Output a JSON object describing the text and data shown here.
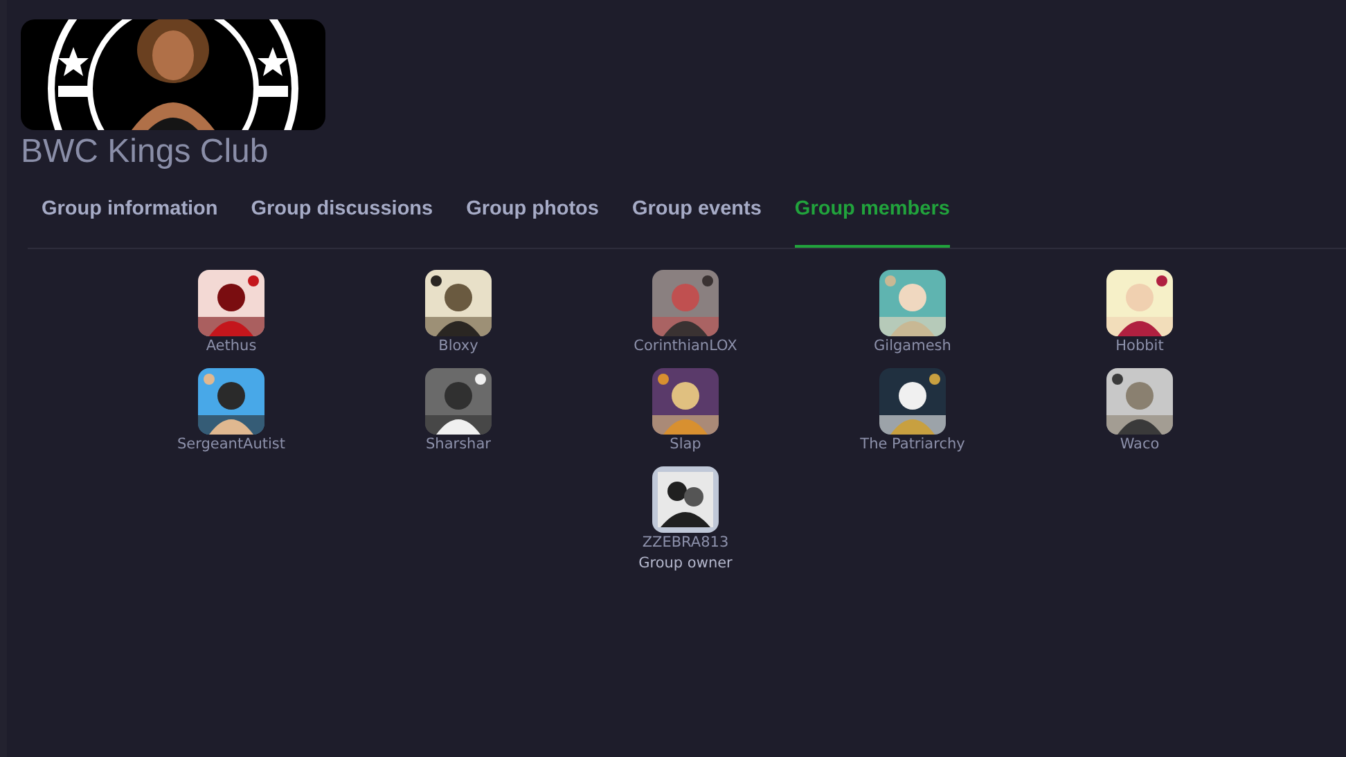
{
  "group": {
    "name": "BWC Kings Club"
  },
  "tabs": [
    {
      "label": "Group information",
      "selected": false
    },
    {
      "label": "Group discussions",
      "selected": false
    },
    {
      "label": "Group photos",
      "selected": false
    },
    {
      "label": "Group events",
      "selected": false
    },
    {
      "label": "Group members",
      "selected": true
    }
  ],
  "members": [
    {
      "name": "Aethus"
    },
    {
      "name": "Bloxy"
    },
    {
      "name": "CorinthianLOX"
    },
    {
      "name": "Gilgamesh"
    },
    {
      "name": "Hobbit"
    },
    {
      "name": "SergeantAutist"
    },
    {
      "name": "Sharshar"
    },
    {
      "name": "Slap"
    },
    {
      "name": "The Patriarchy"
    },
    {
      "name": "Waco"
    }
  ],
  "owner": {
    "name": "ZZEBRA813",
    "role": "Group owner"
  }
}
